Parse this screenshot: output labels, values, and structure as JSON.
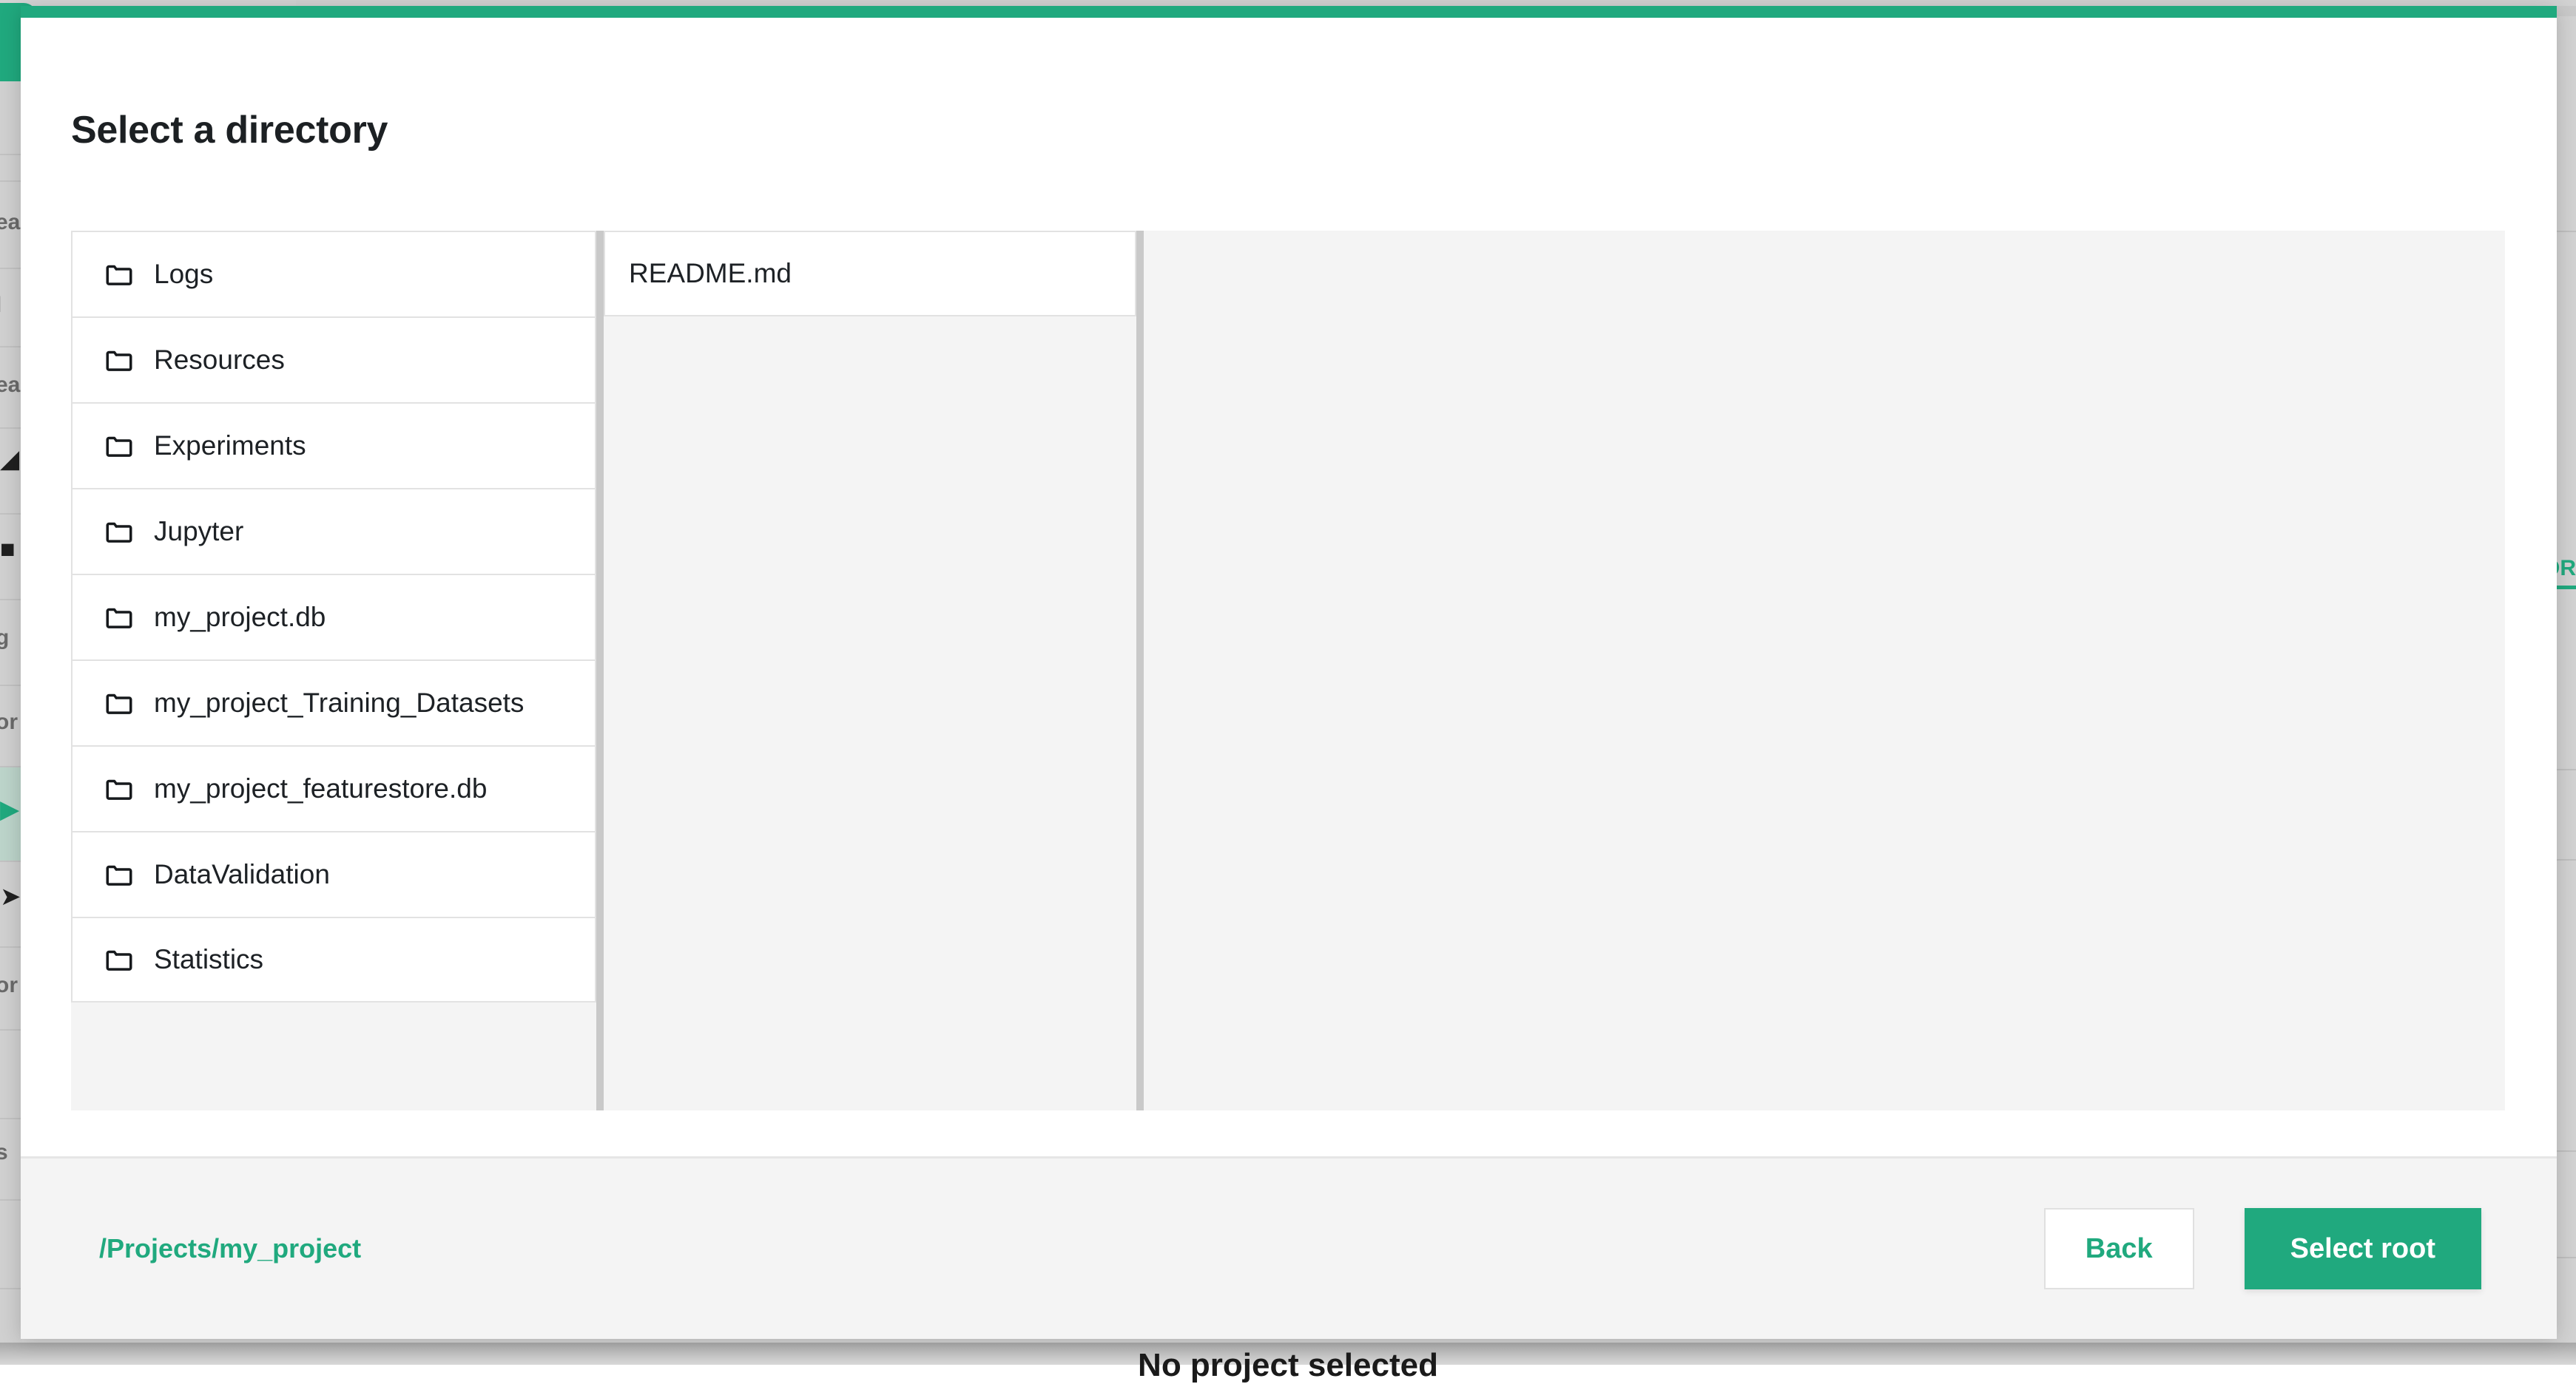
{
  "modal": {
    "title": "Select a directory",
    "accent_color": "#20a97e",
    "columns": [
      {
        "name": "directory-column",
        "items": [
          {
            "label": "Logs",
            "icon": "folder-icon",
            "type": "folder"
          },
          {
            "label": "Resources",
            "icon": "folder-icon",
            "type": "folder"
          },
          {
            "label": "Experiments",
            "icon": "folder-icon",
            "type": "folder"
          },
          {
            "label": "Jupyter",
            "icon": "folder-icon",
            "type": "folder"
          },
          {
            "label": "my_project.db",
            "icon": "folder-icon",
            "type": "folder"
          },
          {
            "label": "my_project_Training_Datasets",
            "icon": "folder-icon",
            "type": "folder"
          },
          {
            "label": "my_project_featurestore.db",
            "icon": "folder-icon",
            "type": "folder"
          },
          {
            "label": "DataValidation",
            "icon": "folder-icon",
            "type": "folder"
          },
          {
            "label": "Statistics",
            "icon": "folder-icon",
            "type": "folder"
          }
        ]
      },
      {
        "name": "file-column",
        "items": [
          {
            "label": "README.md",
            "icon": "none",
            "type": "file"
          }
        ]
      },
      {
        "name": "preview-column",
        "items": []
      }
    ],
    "footer": {
      "path": "/Projects/my_project",
      "path_color": "#20a97e",
      "back_label": "Back",
      "select_root_label": "Select root"
    }
  },
  "background": {
    "sidebar_fragments": [
      {
        "text": "ea"
      },
      {
        "text": "l"
      },
      {
        "text": "ea"
      },
      {
        "text": "◢"
      },
      {
        "text": "■"
      },
      {
        "text": "g"
      },
      {
        "text": "or"
      },
      {
        "text": "▶",
        "accent": true
      },
      {
        "text": "➤"
      },
      {
        "text": "or"
      },
      {
        "text": "s"
      }
    ],
    "right_link_text": "OR",
    "bottom_text": "No project selected"
  }
}
